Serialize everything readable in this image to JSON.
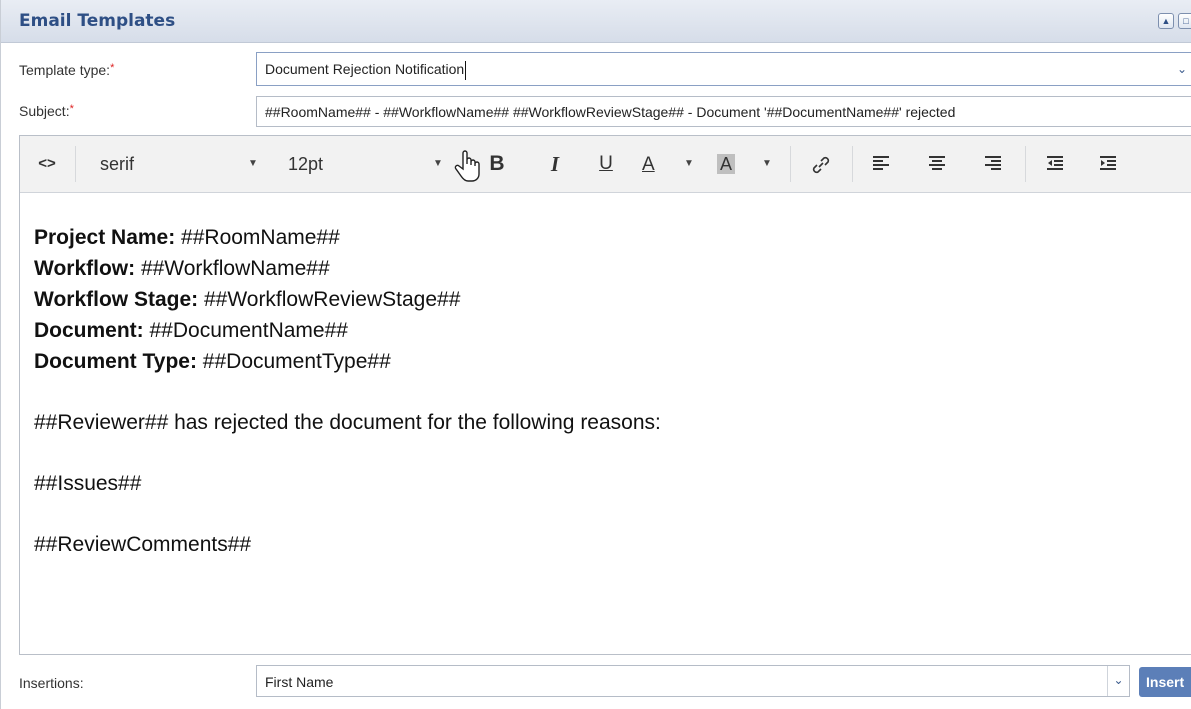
{
  "panel": {
    "title": "Email Templates"
  },
  "form": {
    "template_type_label": "Template type:",
    "template_type_value": "Document Rejection Notification",
    "subject_label": "Subject:",
    "subject_value": "##RoomName## - ##WorkflowName## ##WorkflowReviewStage## - Document '##DocumentName##' rejected",
    "required_marker": "*"
  },
  "toolbar": {
    "source_code_label": "<>",
    "font_family": "serif",
    "font_size": "12pt",
    "bold_label": "B",
    "italic_label": "I",
    "underline_label": "U",
    "text_color_label": "A",
    "bg_color_label": "A",
    "icons": [
      "source-code-icon",
      "bold-icon",
      "italic-icon",
      "underline-icon",
      "text-color-icon",
      "highlight-color-icon",
      "link-icon",
      "align-left-icon",
      "align-center-icon",
      "align-right-icon",
      "outdent-icon",
      "indent-icon",
      "hand-cursor-icon"
    ]
  },
  "body": {
    "fields": [
      {
        "label": "Project Name:",
        "value": " ##RoomName##"
      },
      {
        "label": "Workflow:",
        "value": " ##WorkflowName##"
      },
      {
        "label": "Workflow Stage:",
        "value": " ##WorkflowReviewStage##"
      },
      {
        "label": "Document:",
        "value": " ##DocumentName##"
      },
      {
        "label": "Document Type:",
        "value": " ##DocumentType##"
      }
    ],
    "reason_line": "##Reviewer## has rejected the document for the following reasons:",
    "issues_line": "##Issues##",
    "comments_line": "##ReviewComments##"
  },
  "insertions": {
    "label": "Insertions:",
    "selected": "First Name",
    "insert_button": "Insert"
  }
}
